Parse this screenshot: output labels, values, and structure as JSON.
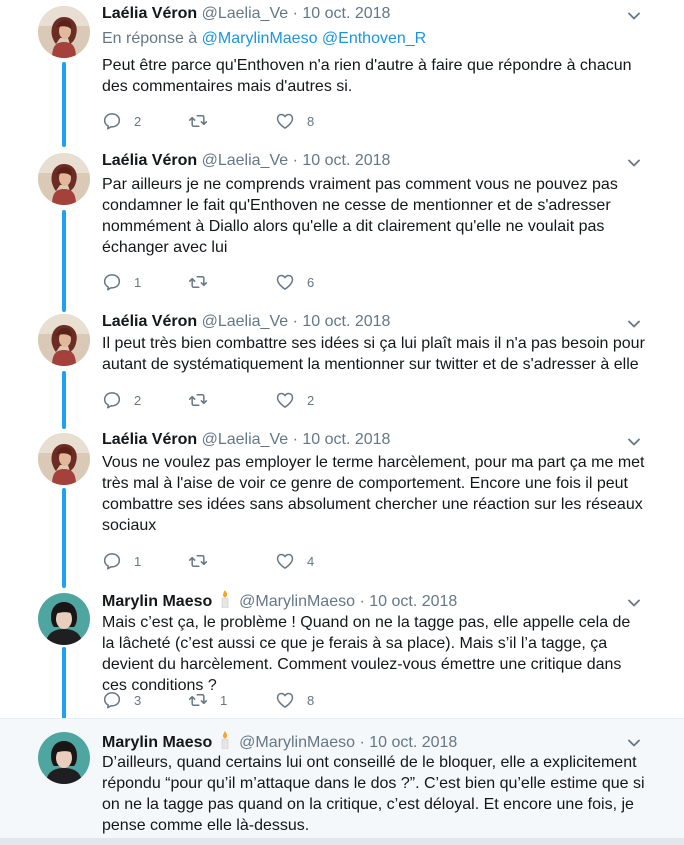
{
  "reply_context": {
    "prefix": "En réponse à",
    "mention1": "@MarylinMaeso",
    "mention2": "@Enthoven_R"
  },
  "tweets": [
    {
      "name": "Laélia Véron",
      "handle": "@Laelia_Ve",
      "separator": "·",
      "date": "10 oct. 2018",
      "text": "Peut être parce qu'Enthoven n'a rien d'autre à faire que répondre à chacun des commentaires mais d'autres si.",
      "replies": "2",
      "retweets": "",
      "likes": "8"
    },
    {
      "name": "Laélia Véron",
      "handle": "@Laelia_Ve",
      "separator": "·",
      "date": "10 oct. 2018",
      "text": "Par ailleurs je ne comprends vraiment pas comment vous ne pouvez pas condamner le fait qu'Enthoven ne cesse de mentionner et de s'adresser nommément à Diallo alors qu'elle a dit clairement qu'elle ne voulait pas échanger avec lui",
      "replies": "1",
      "retweets": "",
      "likes": "6"
    },
    {
      "name": "Laélia Véron",
      "handle": "@Laelia_Ve",
      "separator": "·",
      "date": "10 oct. 2018",
      "text": "Il peut très bien combattre ses idées si ça lui plaît mais il n'a pas besoin pour autant de systématiquement la mentionner sur twitter et de s'adresser à elle",
      "replies": "2",
      "retweets": "",
      "likes": "2"
    },
    {
      "name": "Laélia Véron",
      "handle": "@Laelia_Ve",
      "separator": "·",
      "date": "10 oct. 2018",
      "text": "Vous ne voulez pas employer le terme harcèlement, pour ma part ça me met très mal à l'aise de voir ce genre de comportement. Encore une fois il peut combattre ses idées sans absolument chercher une réaction sur les réseaux sociaux",
      "replies": "1",
      "retweets": "",
      "likes": "4"
    },
    {
      "name": "Marylin Maeso",
      "handle": "@MarylinMaeso",
      "separator": "·",
      "date": "10 oct. 2018",
      "text": "Mais c’est ça, le problème ! Quand on ne la tagge pas, elle appelle cela de la lâcheté (c’est aussi ce que je ferais à sa place). Mais s’il l’a tagge, ça devient du harcèlement. Comment voulez-vous émettre une critique dans ces conditions ?",
      "replies": "3",
      "retweets": "1",
      "likes": "8"
    },
    {
      "name": "Marylin Maeso",
      "handle": "@MarylinMaeso",
      "separator": "·",
      "date": "10 oct. 2018",
      "text": "D’ailleurs, quand certains lui ont conseillé de le bloquer, elle a explicitement répondu “pour qu’il m’attaque dans le dos ?”. C’est bien qu’elle estime que si on ne la tagge pas quand on la critique, c’est déloyal. Et encore une fois, je pense comme elle là-dessus."
    }
  ],
  "colors": {
    "thread_line": "#1da1f2",
    "muted": "#657786",
    "link": "#1b95e0",
    "highlight_bg": "#f5f8fa"
  },
  "icons": [
    "reply-icon",
    "retweet-icon",
    "like-icon",
    "caret-down-icon",
    "candle-icon"
  ]
}
